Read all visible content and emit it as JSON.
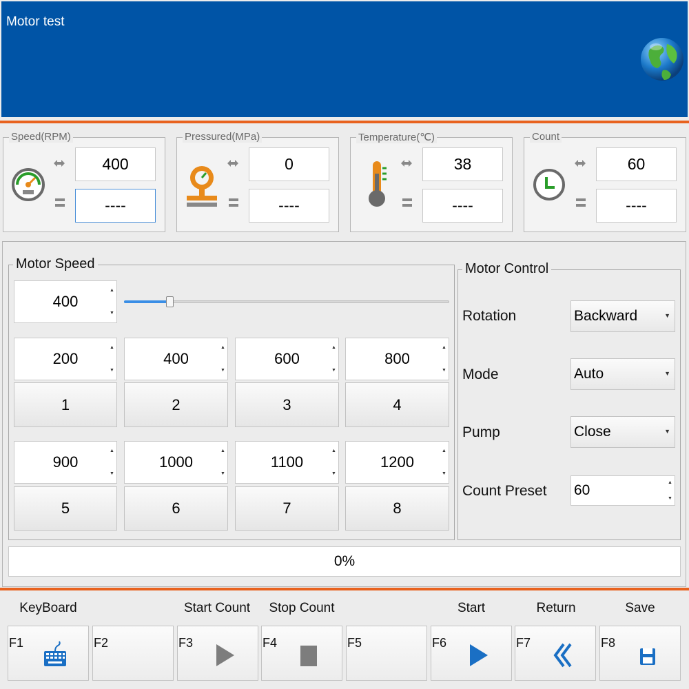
{
  "window": {
    "title": "Motor test"
  },
  "gauges": [
    {
      "legend": "Speed(RPM)",
      "icon": "speedometer-icon",
      "set_value": "400",
      "actual_value": "----"
    },
    {
      "legend": "Pressured(MPa)",
      "icon": "pressure-gauge-icon",
      "set_value": "0",
      "actual_value": "----"
    },
    {
      "legend": "Temperature(℃)",
      "icon": "thermometer-icon",
      "set_value": "38",
      "actual_value": "----"
    },
    {
      "legend": "Count",
      "icon": "clock-icon",
      "set_value": "60",
      "actual_value": "----"
    }
  ],
  "motor_speed": {
    "legend": "Motor Speed",
    "current_value": "400",
    "slider_fraction": 0.125,
    "presets": [
      {
        "value": "200",
        "button": "1"
      },
      {
        "value": "400",
        "button": "2"
      },
      {
        "value": "600",
        "button": "3"
      },
      {
        "value": "800",
        "button": "4"
      },
      {
        "value": "900",
        "button": "5"
      },
      {
        "value": "1000",
        "button": "6"
      },
      {
        "value": "1100",
        "button": "7"
      },
      {
        "value": "1200",
        "button": "8"
      }
    ]
  },
  "motor_control": {
    "legend": "Motor Control",
    "rotation_label": "Rotation",
    "rotation_value": "Backward",
    "mode_label": "Mode",
    "mode_value": "Auto",
    "pump_label": "Pump",
    "pump_value": "Close",
    "count_preset_label": "Count Preset",
    "count_preset_value": "60"
  },
  "progress": {
    "text": "0%",
    "value": 0
  },
  "footer": [
    {
      "key": "F1",
      "caption": "KeyBoard",
      "icon": "keyboard-icon"
    },
    {
      "key": "F2",
      "caption": "",
      "icon": ""
    },
    {
      "key": "F3",
      "caption": "Start Count",
      "icon": "play-gray-icon"
    },
    {
      "key": "F4",
      "caption": "Stop Count",
      "icon": "stop-gray-icon"
    },
    {
      "key": "F5",
      "caption": "",
      "icon": ""
    },
    {
      "key": "F6",
      "caption": "Start",
      "icon": "play-blue-icon"
    },
    {
      "key": "F7",
      "caption": "Return",
      "icon": "double-chevron-left-icon"
    },
    {
      "key": "F8",
      "caption": "Save",
      "icon": "floppy-disk-icon"
    }
  ],
  "colors": {
    "header": "#0054a6",
    "accent": "#e8621e",
    "icon_green": "#2a9d2a",
    "icon_orange": "#e88a1a"
  }
}
